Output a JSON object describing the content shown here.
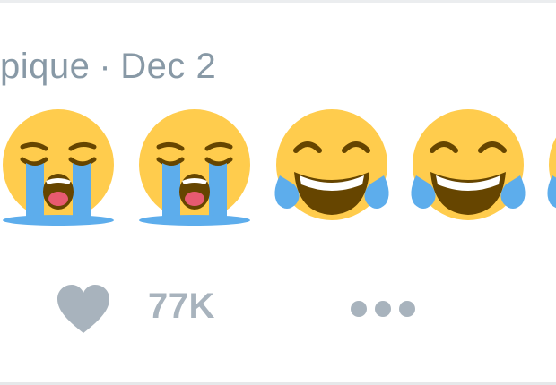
{
  "tweet": {
    "author_handle_fragment": "pique",
    "separator": "·",
    "date": "Dec 2",
    "emojis": [
      {
        "icon": "loudly-crying-face-icon"
      },
      {
        "icon": "loudly-crying-face-icon"
      },
      {
        "icon": "face-with-tears-of-joy-icon"
      },
      {
        "icon": "face-with-tears-of-joy-icon"
      },
      {
        "icon": "face-with-tears-of-joy-icon"
      }
    ]
  },
  "actions": {
    "like_icon": "heart-icon",
    "like_count": "77K",
    "more_icon": "more-dots-icon"
  },
  "colors": {
    "meta_text": "#8899a6",
    "action_gray": "#a8b3bd",
    "emoji_yellow": "#ffcc4d",
    "tear_blue": "#5dadec",
    "mouth_brown": "#664500"
  }
}
